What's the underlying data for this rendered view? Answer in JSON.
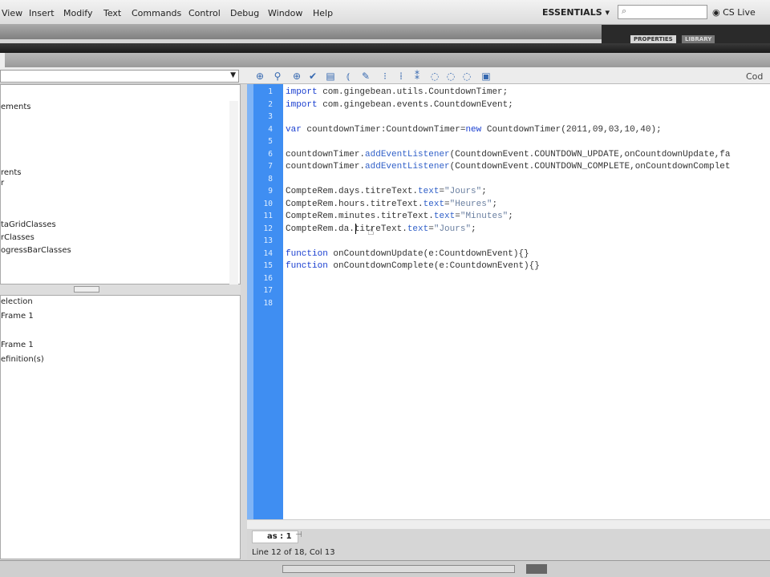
{
  "menu": [
    "View",
    "Insert",
    "Modify",
    "Text",
    "Commands",
    "Control",
    "Debug",
    "Window",
    "Help"
  ],
  "workspace": "ESSENTIALS ▾",
  "search": {
    "placeholder": "⌕"
  },
  "cs_live": "CS Live",
  "panel_tabs": [
    "PROPERTIES",
    "LIBRARY"
  ],
  "toolbar_icons": [
    "add-statement-icon",
    "find-icon",
    "insert-target-path-icon",
    "check-syntax-icon",
    "auto-format-icon",
    "code-hint-icon",
    "debug-options-icon",
    "collapse-braces-icon",
    "collapse-selection-icon",
    "expand-all-icon",
    "apply-block-comment-icon",
    "apply-line-comment-icon",
    "remove-comment-icon",
    "show-hide-toolbox-icon"
  ],
  "code_snippets_label": "Cod",
  "left_tree": [
    "ements",
    "rents",
    "r",
    "taGridClasses",
    "rClasses",
    "ogressBarClasses"
  ],
  "left_bottom": [
    "election",
    "Frame 1",
    "Frame 1",
    "efinition(s)"
  ],
  "code_lines": [
    [
      {
        "t": "import",
        "c": "kw"
      },
      {
        "t": " com.gingebean.utils.CountdownTimer;"
      }
    ],
    [
      {
        "t": "import",
        "c": "kw"
      },
      {
        "t": " com.gingebean.events.CountdownEvent;"
      }
    ],
    [],
    [
      {
        "t": "var",
        "c": "kw"
      },
      {
        "t": " countdownTimer:CountdownTimer="
      },
      {
        "t": "new",
        "c": "kw"
      },
      {
        "t": " CountdownTimer(2011,09,03,10,40);"
      }
    ],
    [],
    [
      {
        "t": "countdownTimer."
      },
      {
        "t": "addEventListener",
        "c": "fn"
      },
      {
        "t": "(CountdownEvent.COUNTDOWN_UPDATE,onCountdownUpdate,fa"
      }
    ],
    [
      {
        "t": "countdownTimer."
      },
      {
        "t": "addEventListener",
        "c": "fn"
      },
      {
        "t": "(CountdownEvent.COUNTDOWN_COMPLETE,onCountdownComplet"
      }
    ],
    [],
    [
      {
        "t": "CompteRem.days.titreText."
      },
      {
        "t": "text",
        "c": "fn"
      },
      {
        "t": "="
      },
      {
        "t": "\"Jours\"",
        "c": "str"
      },
      {
        "t": ";"
      }
    ],
    [
      {
        "t": "CompteRem.hours.titreText."
      },
      {
        "t": "text",
        "c": "fn"
      },
      {
        "t": "="
      },
      {
        "t": "\"Heures\"",
        "c": "str"
      },
      {
        "t": ";"
      }
    ],
    [
      {
        "t": "CompteRem.minutes.titreText."
      },
      {
        "t": "text",
        "c": "fn"
      },
      {
        "t": "="
      },
      {
        "t": "\"Minutes\"",
        "c": "str"
      },
      {
        "t": ";"
      }
    ],
    [
      {
        "t": "CompteRem.da.titreText."
      },
      {
        "t": "text",
        "c": "fn"
      },
      {
        "t": "="
      },
      {
        "t": "\"Jours\"",
        "c": "str"
      },
      {
        "t": ";"
      }
    ],
    [],
    [
      {
        "t": "function",
        "c": "kw"
      },
      {
        "t": " onCountdownUpdate(e:CountdownEvent){}"
      }
    ],
    [
      {
        "t": "function",
        "c": "kw"
      },
      {
        "t": " onCountdownComplete(e:CountdownEvent){}"
      }
    ],
    [],
    [],
    []
  ],
  "file_tab": "as : 1",
  "status": "Line 12 of 18, Col 13"
}
